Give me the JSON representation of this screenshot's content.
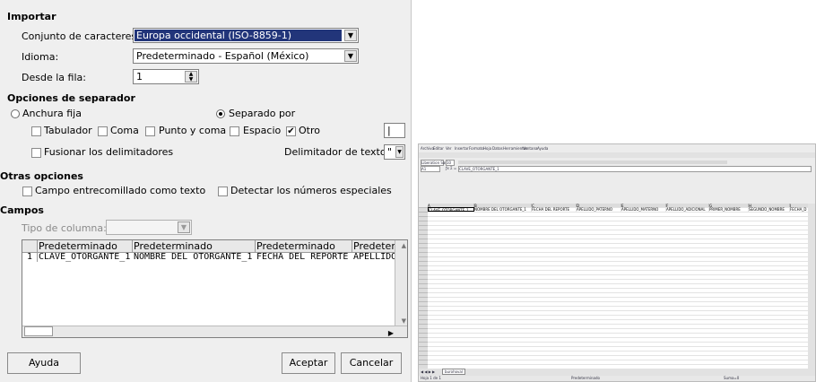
{
  "dialog": {
    "importar": {
      "header": "Importar",
      "charset_label": "Conjunto de caracteres:",
      "charset_value": "Europa occidental (ISO-8859-1)",
      "language_label": "Idioma:",
      "language_value": "Predeterminado - Español (México)",
      "fromrow_label": "Desde la fila:",
      "fromrow_value": "1"
    },
    "separator": {
      "header": "Opciones de separador",
      "fixed_label": "Anchura fija",
      "separated_label": "Separado por",
      "tab_label": "Tabulador",
      "comma_label": "Coma",
      "semicolon_label": "Punto y coma",
      "space_label": "Espacio",
      "other_label": "Otro",
      "other_value": "|",
      "merge_label": "Fusionar los delimitadores",
      "textdelim_label": "Delimitador de texto:",
      "textdelim_value": "\""
    },
    "other_options": {
      "header": "Otras opciones",
      "quoted_label": "Campo entrecomillado como texto",
      "detect_label": "Detectar los números especiales"
    },
    "fields": {
      "header": "Campos",
      "coltype_label": "Tipo de columna:",
      "columns": [
        "Predeterminado",
        "Predeterminado",
        "Predeterminado",
        "Predeterm"
      ],
      "row_number": "1",
      "row_cells": [
        "CLAVE_OTORGANTE_1",
        "NOMBRE DEL OTORGANTE_1",
        "FECHA DEL REPORTE",
        "APELLIDO"
      ]
    },
    "buttons": {
      "help": "Ayuda",
      "ok": "Aceptar",
      "cancel": "Cancelar"
    }
  },
  "spreadsheet": {
    "menu": [
      "Archivo",
      "Editar",
      "Ver",
      "Insertar",
      "Formato",
      "Hoja",
      "Datos",
      "Herramientas",
      "Ventana",
      "Ayuda"
    ],
    "font_name": "Liberation Sans",
    "font_size": "10",
    "cell_ref": "A1",
    "formula_value": "CLAVE_OTORGANTE_1",
    "col_letters": [
      "A",
      "B",
      "C",
      "D",
      "E",
      "F",
      "G",
      "H",
      "I"
    ],
    "headers": [
      "CLAVE_OTORGANTE_1",
      "NOMBRE DEL OTORGANTE_1",
      "FECHA DEL REPORTE",
      "APELLIDO_PATERNO",
      "APELLIDO_MATERNO",
      "APELLIDO_ADICIONAL",
      "PRIMER_NOMBRE",
      "SEGUNDO_NOMBRE",
      "FECHA_D"
    ],
    "sheet_tab": "burohoval",
    "status_left": "Hoja 1 de 1",
    "status_mid": "Predeterminado",
    "status_right": "Suma=0"
  }
}
